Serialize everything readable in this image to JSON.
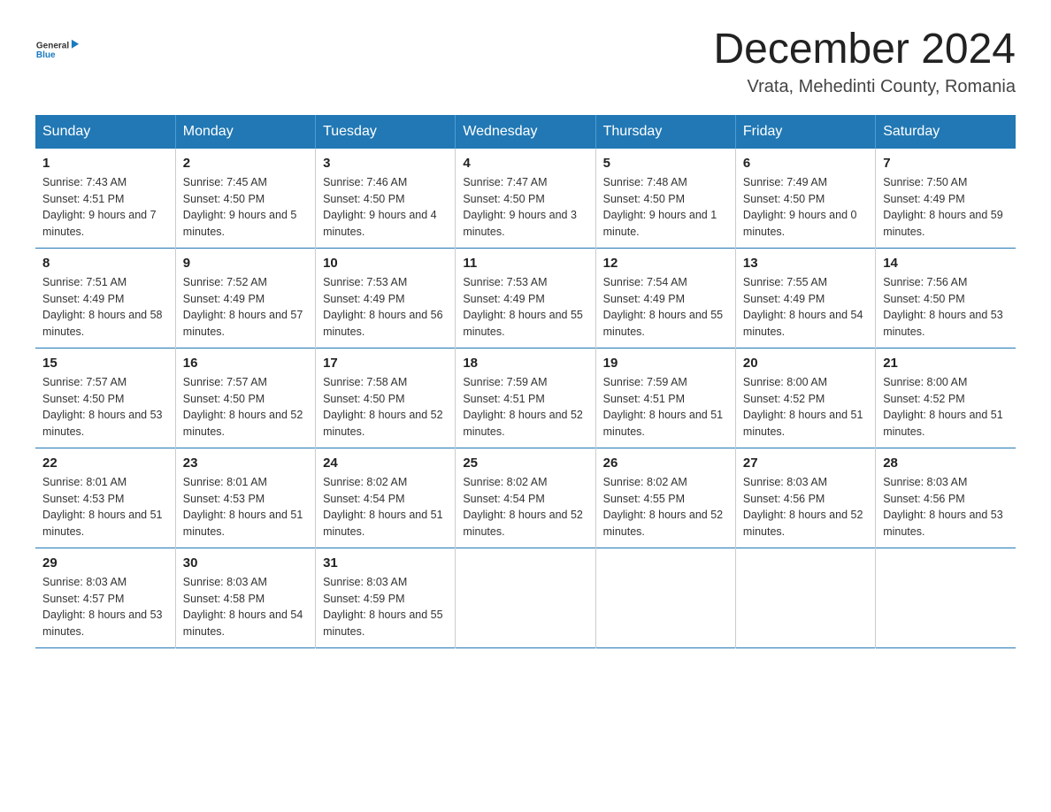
{
  "logo": {
    "general": "General",
    "blue": "Blue"
  },
  "header": {
    "month_year": "December 2024",
    "location": "Vrata, Mehedinti County, Romania"
  },
  "days_of_week": [
    "Sunday",
    "Monday",
    "Tuesday",
    "Wednesday",
    "Thursday",
    "Friday",
    "Saturday"
  ],
  "weeks": [
    [
      {
        "day": "1",
        "sunrise": "7:43 AM",
        "sunset": "4:51 PM",
        "daylight": "9 hours and 7 minutes."
      },
      {
        "day": "2",
        "sunrise": "7:45 AM",
        "sunset": "4:50 PM",
        "daylight": "9 hours and 5 minutes."
      },
      {
        "day": "3",
        "sunrise": "7:46 AM",
        "sunset": "4:50 PM",
        "daylight": "9 hours and 4 minutes."
      },
      {
        "day": "4",
        "sunrise": "7:47 AM",
        "sunset": "4:50 PM",
        "daylight": "9 hours and 3 minutes."
      },
      {
        "day": "5",
        "sunrise": "7:48 AM",
        "sunset": "4:50 PM",
        "daylight": "9 hours and 1 minute."
      },
      {
        "day": "6",
        "sunrise": "7:49 AM",
        "sunset": "4:50 PM",
        "daylight": "9 hours and 0 minutes."
      },
      {
        "day": "7",
        "sunrise": "7:50 AM",
        "sunset": "4:49 PM",
        "daylight": "8 hours and 59 minutes."
      }
    ],
    [
      {
        "day": "8",
        "sunrise": "7:51 AM",
        "sunset": "4:49 PM",
        "daylight": "8 hours and 58 minutes."
      },
      {
        "day": "9",
        "sunrise": "7:52 AM",
        "sunset": "4:49 PM",
        "daylight": "8 hours and 57 minutes."
      },
      {
        "day": "10",
        "sunrise": "7:53 AM",
        "sunset": "4:49 PM",
        "daylight": "8 hours and 56 minutes."
      },
      {
        "day": "11",
        "sunrise": "7:53 AM",
        "sunset": "4:49 PM",
        "daylight": "8 hours and 55 minutes."
      },
      {
        "day": "12",
        "sunrise": "7:54 AM",
        "sunset": "4:49 PM",
        "daylight": "8 hours and 55 minutes."
      },
      {
        "day": "13",
        "sunrise": "7:55 AM",
        "sunset": "4:49 PM",
        "daylight": "8 hours and 54 minutes."
      },
      {
        "day": "14",
        "sunrise": "7:56 AM",
        "sunset": "4:50 PM",
        "daylight": "8 hours and 53 minutes."
      }
    ],
    [
      {
        "day": "15",
        "sunrise": "7:57 AM",
        "sunset": "4:50 PM",
        "daylight": "8 hours and 53 minutes."
      },
      {
        "day": "16",
        "sunrise": "7:57 AM",
        "sunset": "4:50 PM",
        "daylight": "8 hours and 52 minutes."
      },
      {
        "day": "17",
        "sunrise": "7:58 AM",
        "sunset": "4:50 PM",
        "daylight": "8 hours and 52 minutes."
      },
      {
        "day": "18",
        "sunrise": "7:59 AM",
        "sunset": "4:51 PM",
        "daylight": "8 hours and 52 minutes."
      },
      {
        "day": "19",
        "sunrise": "7:59 AM",
        "sunset": "4:51 PM",
        "daylight": "8 hours and 51 minutes."
      },
      {
        "day": "20",
        "sunrise": "8:00 AM",
        "sunset": "4:52 PM",
        "daylight": "8 hours and 51 minutes."
      },
      {
        "day": "21",
        "sunrise": "8:00 AM",
        "sunset": "4:52 PM",
        "daylight": "8 hours and 51 minutes."
      }
    ],
    [
      {
        "day": "22",
        "sunrise": "8:01 AM",
        "sunset": "4:53 PM",
        "daylight": "8 hours and 51 minutes."
      },
      {
        "day": "23",
        "sunrise": "8:01 AM",
        "sunset": "4:53 PM",
        "daylight": "8 hours and 51 minutes."
      },
      {
        "day": "24",
        "sunrise": "8:02 AM",
        "sunset": "4:54 PM",
        "daylight": "8 hours and 51 minutes."
      },
      {
        "day": "25",
        "sunrise": "8:02 AM",
        "sunset": "4:54 PM",
        "daylight": "8 hours and 52 minutes."
      },
      {
        "day": "26",
        "sunrise": "8:02 AM",
        "sunset": "4:55 PM",
        "daylight": "8 hours and 52 minutes."
      },
      {
        "day": "27",
        "sunrise": "8:03 AM",
        "sunset": "4:56 PM",
        "daylight": "8 hours and 52 minutes."
      },
      {
        "day": "28",
        "sunrise": "8:03 AM",
        "sunset": "4:56 PM",
        "daylight": "8 hours and 53 minutes."
      }
    ],
    [
      {
        "day": "29",
        "sunrise": "8:03 AM",
        "sunset": "4:57 PM",
        "daylight": "8 hours and 53 minutes."
      },
      {
        "day": "30",
        "sunrise": "8:03 AM",
        "sunset": "4:58 PM",
        "daylight": "8 hours and 54 minutes."
      },
      {
        "day": "31",
        "sunrise": "8:03 AM",
        "sunset": "4:59 PM",
        "daylight": "8 hours and 55 minutes."
      },
      null,
      null,
      null,
      null
    ]
  ],
  "labels": {
    "sunrise_prefix": "Sunrise: ",
    "sunset_prefix": "Sunset: ",
    "daylight_prefix": "Daylight: "
  }
}
